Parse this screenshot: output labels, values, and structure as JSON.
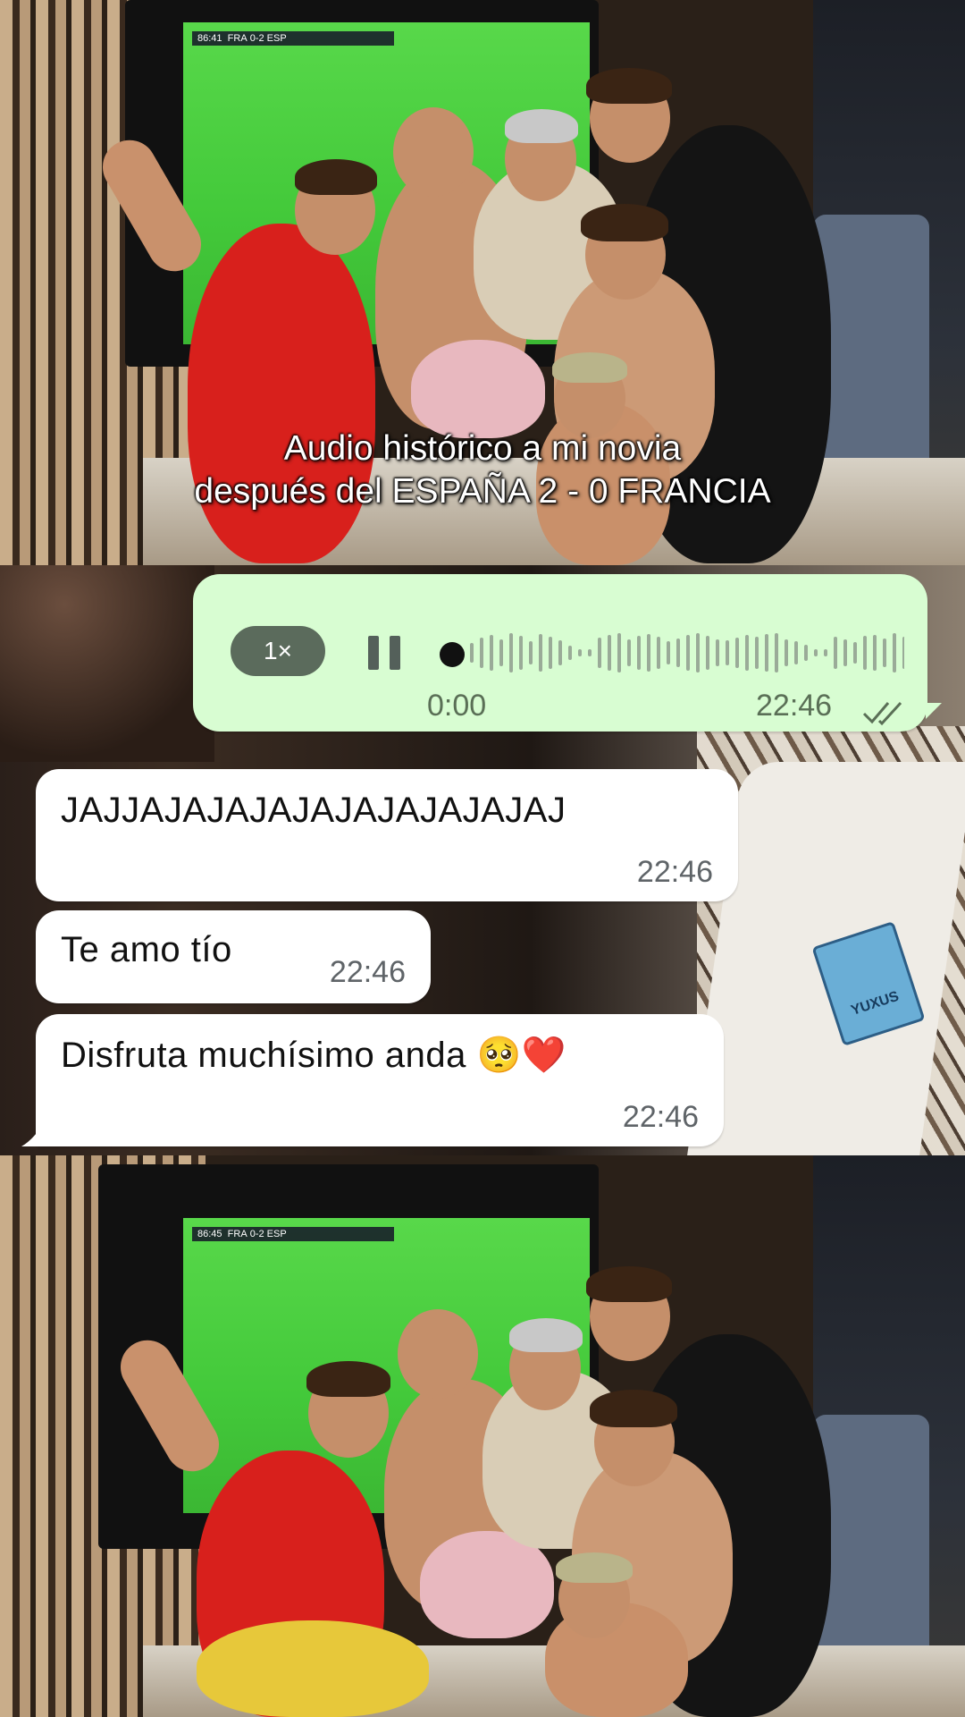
{
  "caption": {
    "line1": "Audio histórico a mi novia",
    "line2": "después del ESPAÑA 2 - 0 FRANCIA"
  },
  "tv_scoreboard": {
    "clock": "86:41",
    "home": "FRA",
    "away": "ESP"
  },
  "tv_scoreboard_bottom": {
    "clock": "86:45",
    "home": "FRA",
    "away": "ESP"
  },
  "voice_message": {
    "speed": "1×",
    "position": "0:00",
    "sent_time": "22:46",
    "progress": 0.0,
    "status": "read",
    "bubble_color": "#d8fdd2"
  },
  "messages": [
    {
      "text": "JAJJAJAJAJAJAJAJAJAJAJAJ",
      "time": "22:46"
    },
    {
      "text": "Te amo tío",
      "time": "22:46"
    },
    {
      "text": "Disfruta muchísimo anda 🥺❤️",
      "time": "22:46"
    }
  ],
  "shirt_tag": "YUXUS",
  "colors": {
    "incoming_bubble": "#ffffff",
    "outgoing_bubble": "#d8fdd2",
    "speed_chip": "#5b6b5c"
  }
}
